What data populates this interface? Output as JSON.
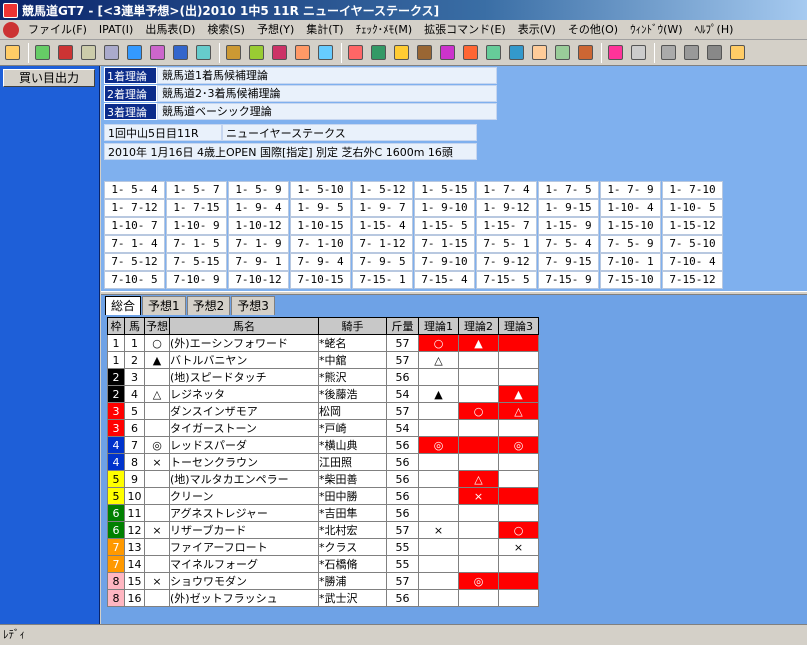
{
  "window": {
    "title": "競馬道GT7 - [<3連単予想>(出)2010 1中5 11R ニューイヤーステークス]"
  },
  "menu": [
    "ファイル(F)",
    "IPAT(I)",
    "出馬表(D)",
    "検索(S)",
    "予想(Y)",
    "集計(T)",
    "ﾁｪｯｸ･ﾒﾓ(M)",
    "拡張コマンド(E)",
    "表示(V)",
    "その他(O)",
    "ｳｨﾝﾄﾞｳ(W)",
    "ﾍﾙﾌﾟ(H)"
  ],
  "sidebar": {
    "buy_label": "買い目出力"
  },
  "theories": [
    {
      "label": "1着理論",
      "value": "競馬道1着馬候補理論"
    },
    {
      "label": "2着理論",
      "value": "競馬道2･3着馬候補理論"
    },
    {
      "label": "3着理論",
      "value": "競馬道ベーシック理論"
    }
  ],
  "race": {
    "info": "1回中山5日目11R",
    "name": "ニューイヤーステークス",
    "detail": "2010年 1月16日 4歳上OPEN 国際[指定] 別定 芝右外C 1600m 16頭"
  },
  "combos": [
    [
      "1- 5- 4",
      "1- 5- 7",
      "1- 5- 9",
      "1- 5-10",
      "1- 5-12",
      "1- 5-15",
      "1- 7- 4",
      "1- 7- 5",
      "1- 7- 9",
      "1- 7-10"
    ],
    [
      "1- 7-12",
      "1- 7-15",
      "1- 9- 4",
      "1- 9- 5",
      "1- 9- 7",
      "1- 9-10",
      "1- 9-12",
      "1- 9-15",
      "1-10- 4",
      "1-10- 5"
    ],
    [
      "1-10- 7",
      "1-10- 9",
      "1-10-12",
      "1-10-15",
      "1-15- 4",
      "1-15- 5",
      "1-15- 7",
      "1-15- 9",
      "1-15-10",
      "1-15-12"
    ],
    [
      "7- 1- 4",
      "7- 1- 5",
      "7- 1- 9",
      "7- 1-10",
      "7- 1-12",
      "7- 1-15",
      "7- 5- 1",
      "7- 5- 4",
      "7- 5- 9",
      "7- 5-10"
    ],
    [
      "7- 5-12",
      "7- 5-15",
      "7- 9- 1",
      "7- 9- 4",
      "7- 9- 5",
      "7- 9-10",
      "7- 9-12",
      "7- 9-15",
      "7-10- 1",
      "7-10- 4"
    ],
    [
      "7-10- 5",
      "7-10- 9",
      "7-10-12",
      "7-10-15",
      "7-15- 1",
      "7-15- 4",
      "7-15- 5",
      "7-15- 9",
      "7-15-10",
      "7-15-12"
    ]
  ],
  "tabs": [
    "総合",
    "予想1",
    "予想2",
    "予想3"
  ],
  "table": {
    "headers": [
      "枠",
      "馬",
      "予想",
      "馬名",
      "騎手",
      "斤量",
      "理論1",
      "理論2",
      "理論3"
    ],
    "rows": [
      {
        "waku": "1",
        "uma": "1",
        "pred": "○",
        "name": "(外)エーシンフォワード",
        "jockey": "*蛯名",
        "weight": "57",
        "t1": "○",
        "t2": "▲",
        "t3": "",
        "r1": true,
        "r2": true,
        "r3": true
      },
      {
        "waku": "1",
        "uma": "2",
        "pred": "▲",
        "name": "バトルバニヤン",
        "jockey": "*中舘",
        "weight": "57",
        "t1": "△",
        "t2": "",
        "t3": "",
        "r1": false,
        "r2": false,
        "r3": false
      },
      {
        "waku": "2",
        "uma": "3",
        "pred": "",
        "name": "(地)スピードタッチ",
        "jockey": "*熊沢",
        "weight": "56",
        "t1": "",
        "t2": "",
        "t3": "",
        "r1": false,
        "r2": false,
        "r3": false
      },
      {
        "waku": "2",
        "uma": "4",
        "pred": "△",
        "name": "レジネッタ",
        "jockey": "*後藤浩",
        "weight": "54",
        "t1": "▲",
        "t2": "",
        "t3": "▲",
        "r1": false,
        "r2": false,
        "r3": true
      },
      {
        "waku": "3",
        "uma": "5",
        "pred": "",
        "name": "ダンスインザモア",
        "jockey": "松岡",
        "weight": "57",
        "t1": "",
        "t2": "○",
        "t3": "△",
        "r1": false,
        "r2": true,
        "r3": true
      },
      {
        "waku": "3",
        "uma": "6",
        "pred": "",
        "name": "タイガーストーン",
        "jockey": "*戸崎",
        "weight": "54",
        "t1": "",
        "t2": "",
        "t3": "",
        "r1": false,
        "r2": false,
        "r3": false
      },
      {
        "waku": "4",
        "uma": "7",
        "pred": "◎",
        "name": "レッドスパーダ",
        "jockey": "*横山典",
        "weight": "56",
        "t1": "◎",
        "t2": "",
        "t3": "◎",
        "r1": true,
        "r2": true,
        "r3": true
      },
      {
        "waku": "4",
        "uma": "8",
        "pred": "×",
        "name": "トーセンクラウン",
        "jockey": "江田照",
        "weight": "56",
        "t1": "",
        "t2": "",
        "t3": "",
        "r1": false,
        "r2": false,
        "r3": false
      },
      {
        "waku": "5",
        "uma": "9",
        "pred": "",
        "name": "(地)マルタカエンペラー",
        "jockey": "*柴田善",
        "weight": "56",
        "t1": "",
        "t2": "△",
        "t3": "",
        "r1": false,
        "r2": true,
        "r3": false
      },
      {
        "waku": "5",
        "uma": "10",
        "pred": "",
        "name": "クリーン",
        "jockey": "*田中勝",
        "weight": "56",
        "t1": "",
        "t2": "×",
        "t3": "",
        "r1": false,
        "r2": true,
        "r3": true
      },
      {
        "waku": "6",
        "uma": "11",
        "pred": "",
        "name": "アグネストレジャー",
        "jockey": "*吉田隼",
        "weight": "56",
        "t1": "",
        "t2": "",
        "t3": "",
        "r1": false,
        "r2": false,
        "r3": false
      },
      {
        "waku": "6",
        "uma": "12",
        "pred": "×",
        "name": "リザーブカード",
        "jockey": "*北村宏",
        "weight": "57",
        "t1": "×",
        "t2": "",
        "t3": "○",
        "r1": false,
        "r2": false,
        "r3": true
      },
      {
        "waku": "7",
        "uma": "13",
        "pred": "",
        "name": "ファイアーフロート",
        "jockey": "*クラス",
        "weight": "55",
        "t1": "",
        "t2": "",
        "t3": "×",
        "r1": false,
        "r2": false,
        "r3": false
      },
      {
        "waku": "7",
        "uma": "14",
        "pred": "",
        "name": "マイネルフォーグ",
        "jockey": "*石橋脩",
        "weight": "55",
        "t1": "",
        "t2": "",
        "t3": "",
        "r1": false,
        "r2": false,
        "r3": false
      },
      {
        "waku": "8",
        "uma": "15",
        "pred": "×",
        "name": "ショウワモダン",
        "jockey": "*勝浦",
        "weight": "57",
        "t1": "",
        "t2": "◎",
        "t3": "",
        "r1": false,
        "r2": true,
        "r3": true
      },
      {
        "waku": "8",
        "uma": "16",
        "pred": "",
        "name": "(外)ゼットフラッシュ",
        "jockey": "*武士沢",
        "weight": "56",
        "t1": "",
        "t2": "",
        "t3": "",
        "r1": false,
        "r2": false,
        "r3": false
      }
    ]
  },
  "waku_colors": {
    "1": [
      "#ffffff",
      "#000000"
    ],
    "2": [
      "#000000",
      "#ffffff"
    ],
    "3": [
      "#ff0000",
      "#ffffff"
    ],
    "4": [
      "#0033cc",
      "#ffffff"
    ],
    "5": [
      "#ffff00",
      "#000000"
    ],
    "6": [
      "#008000",
      "#ffffff"
    ],
    "7": [
      "#ff9900",
      "#ffffff"
    ],
    "8": [
      "#ffb6c1",
      "#000000"
    ]
  },
  "status": {
    "text": "ﾚﾃﾞｨ"
  }
}
